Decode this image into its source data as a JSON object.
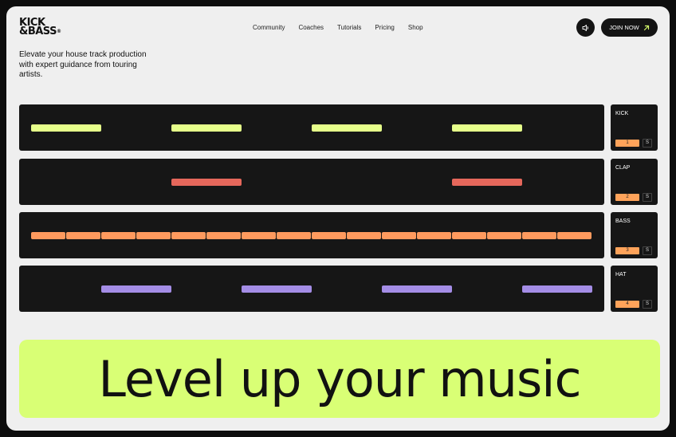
{
  "brand": {
    "line1": "KICK",
    "line2": "&BASS",
    "mark": "®"
  },
  "nav": [
    "Community",
    "Coaches",
    "Tutorials",
    "Pricing",
    "Shop"
  ],
  "header": {
    "join_label": "JOIN NOW",
    "sound_icon": "speaker-icon",
    "join_icon": "arrow-up-right-icon"
  },
  "hero": {
    "tagline": "Elevate your house track production with expert guidance from touring artists."
  },
  "tracks": [
    {
      "name": "KICK",
      "number": "1",
      "solo": "S",
      "color": "#e6ff8a",
      "steps": [
        0,
        4,
        8,
        12
      ]
    },
    {
      "name": "CLAP",
      "number": "2",
      "solo": "S",
      "color": "#e5675b",
      "steps": [
        4,
        12
      ]
    },
    {
      "name": "BASS",
      "number": "3",
      "solo": "S",
      "color": "#ff9a5e",
      "steps": [
        0,
        1,
        2,
        3,
        4,
        5,
        6,
        7,
        8,
        9,
        10,
        11,
        12,
        13,
        14,
        15
      ]
    },
    {
      "name": "HAT",
      "number": "4",
      "solo": "S",
      "color": "#a48de6",
      "steps": [
        2,
        6,
        10,
        14
      ]
    }
  ],
  "cta": {
    "text": "Level up your music"
  },
  "colors": {
    "accent": "#d9ff75",
    "dark": "#161616"
  }
}
